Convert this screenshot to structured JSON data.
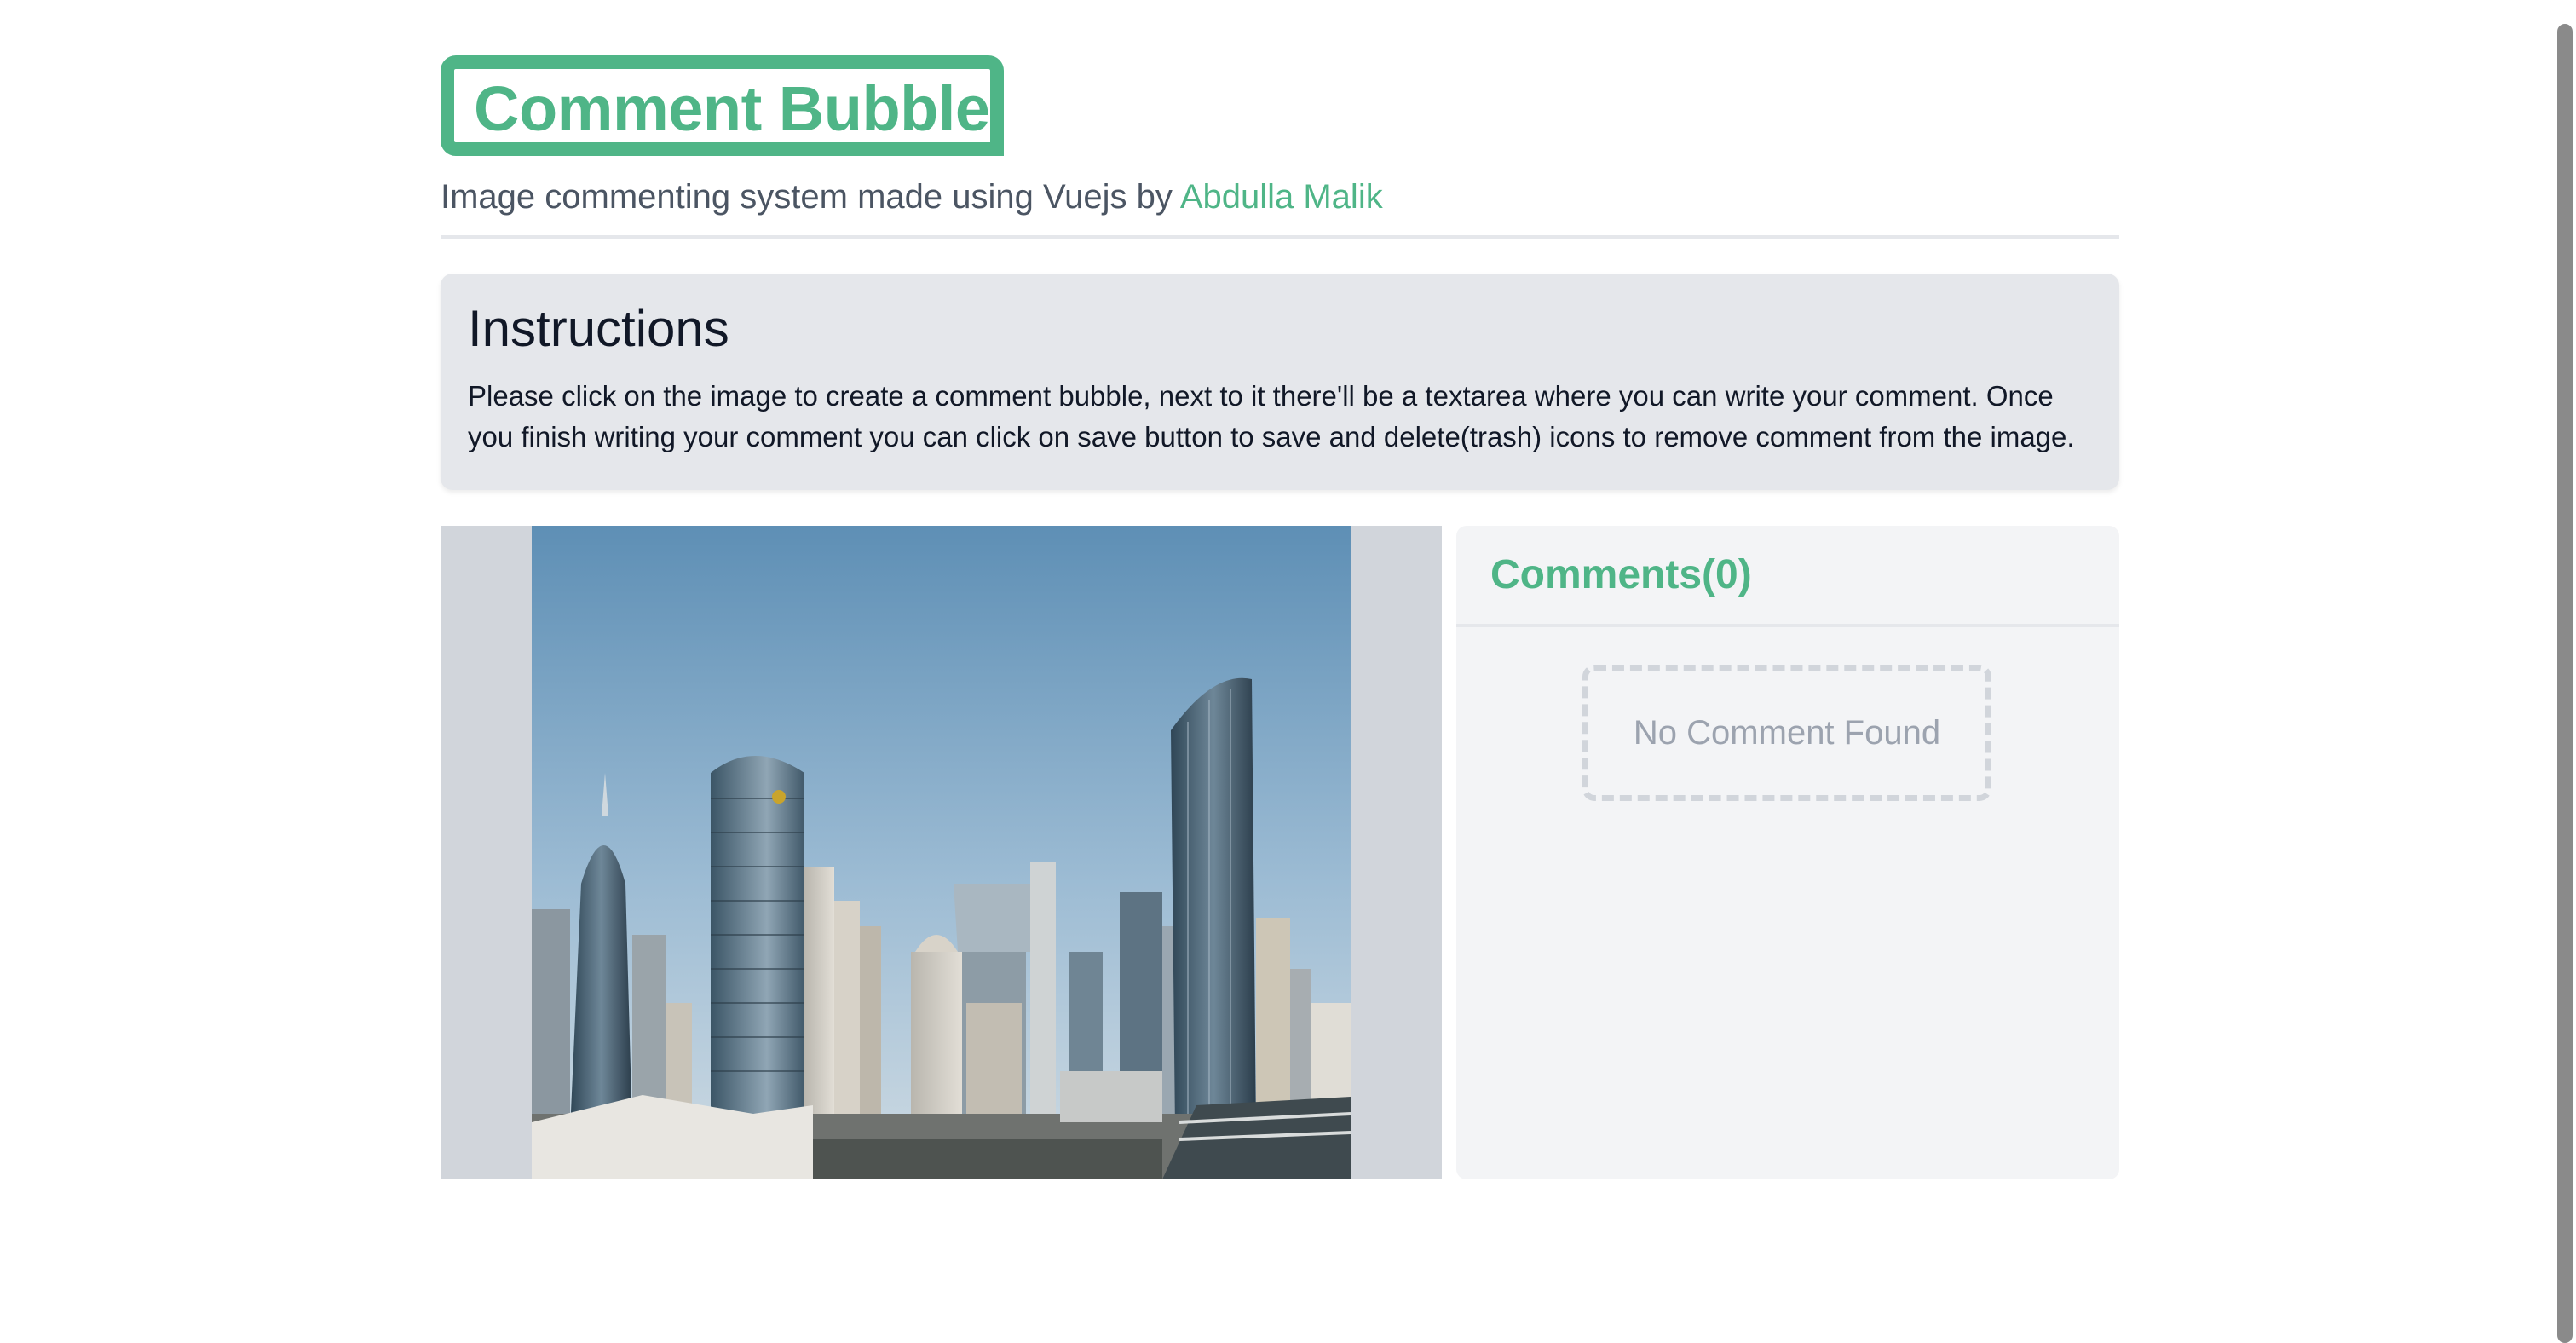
{
  "header": {
    "logo_text": "Comment Bubble",
    "subtitle_prefix": "Image commenting system made using Vuejs by",
    "author_link": "Abdulla Malik"
  },
  "instructions": {
    "title": "Instructions",
    "body": "Please click on the image to create a comment bubble, next to it there'll be a textarea where you can write your comment. Once you finish writing your comment you can click on save button to save and delete(trash) icons to remove comment from the image."
  },
  "comments": {
    "title": "Comments(0)",
    "empty_message": "No Comment Found"
  },
  "colors": {
    "accent": "#4fb587",
    "panel": "#e5e7eb",
    "muted": "#9ca3af"
  }
}
